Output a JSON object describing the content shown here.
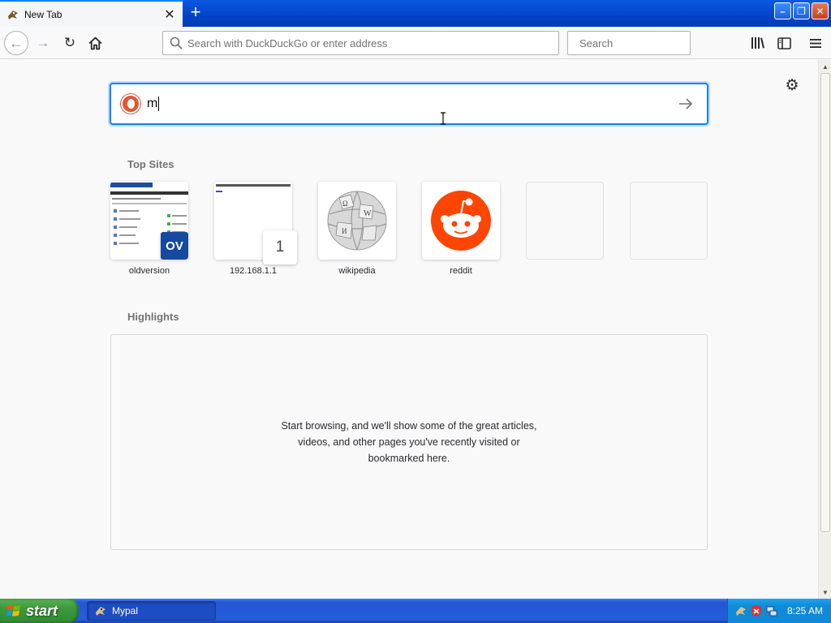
{
  "browser": {
    "tab": {
      "title": "New Tab"
    },
    "toolbar": {
      "url_placeholder": "Search with DuckDuckGo or enter address",
      "search_placeholder": "Search"
    }
  },
  "newtab": {
    "search_query": "m",
    "top_sites_heading": "Top Sites",
    "top_sites": [
      {
        "label": "oldversion"
      },
      {
        "label": "192.168.1.1",
        "badge": "1"
      },
      {
        "label": "wikipedia"
      },
      {
        "label": "reddit"
      },
      {
        "label": ""
      },
      {
        "label": ""
      }
    ],
    "highlights_heading": "Highlights",
    "highlights_empty": "Start browsing, and we'll show some of the great articles, videos, and other pages you've recently visited or bookmarked here."
  },
  "taskbar": {
    "start_label": "start",
    "task": "Mypal",
    "clock": "8:25 AM"
  },
  "colors": {
    "accent": "#0a84ff",
    "reddit": "#ff4500",
    "taskbar_blue": "#245edb",
    "start_green": "#3c9a3c"
  }
}
